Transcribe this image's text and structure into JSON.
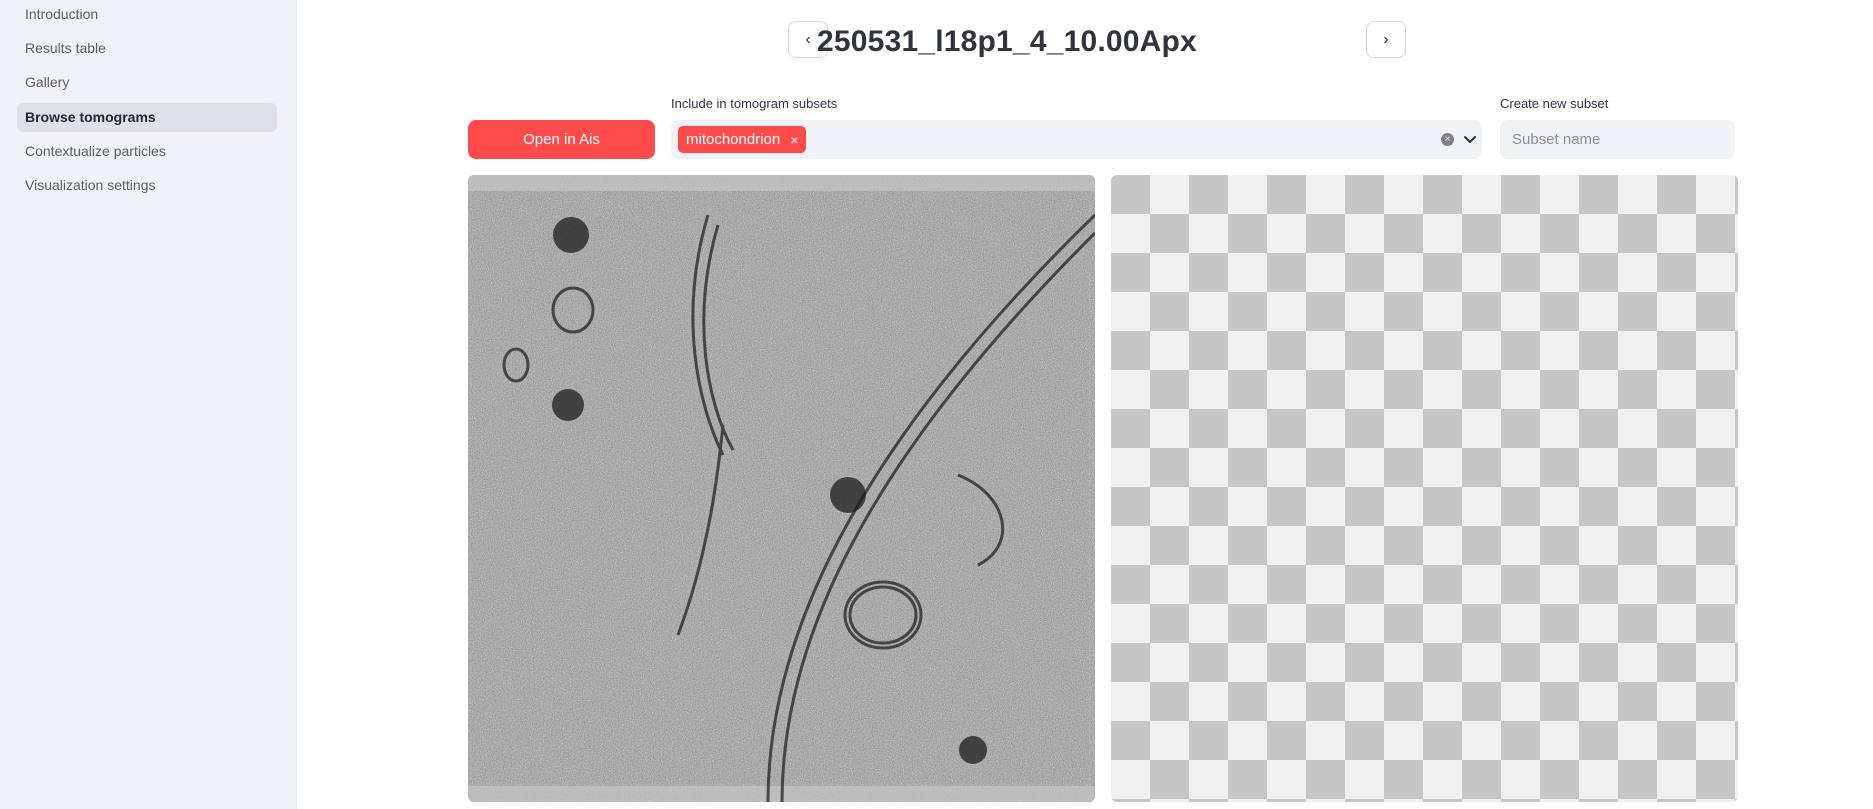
{
  "sidebar": {
    "items": [
      {
        "label": "Introduction",
        "active": false
      },
      {
        "label": "Results table",
        "active": false
      },
      {
        "label": "Gallery",
        "active": false
      },
      {
        "label": "Browse tomograms",
        "active": true
      },
      {
        "label": "Contextualize particles",
        "active": false
      },
      {
        "label": "Visualization settings",
        "active": false
      }
    ]
  },
  "header": {
    "title": "250531_l18p1_4_10.00Apx",
    "prev_icon": "‹",
    "next_icon": "›"
  },
  "controls": {
    "open_button_label": "Open in Ais",
    "subsets_label": "Include in tomogram subsets",
    "selected_tags": [
      "mitochondrion"
    ],
    "tag_remove_glyph": "×",
    "clear_glyph": "×",
    "create_label": "Create new subset",
    "create_placeholder": "Subset name"
  },
  "colors": {
    "accent": "#ff4b4b",
    "sidebar_bg": "#f0f2f6",
    "input_bg": "#f0f2f6"
  }
}
